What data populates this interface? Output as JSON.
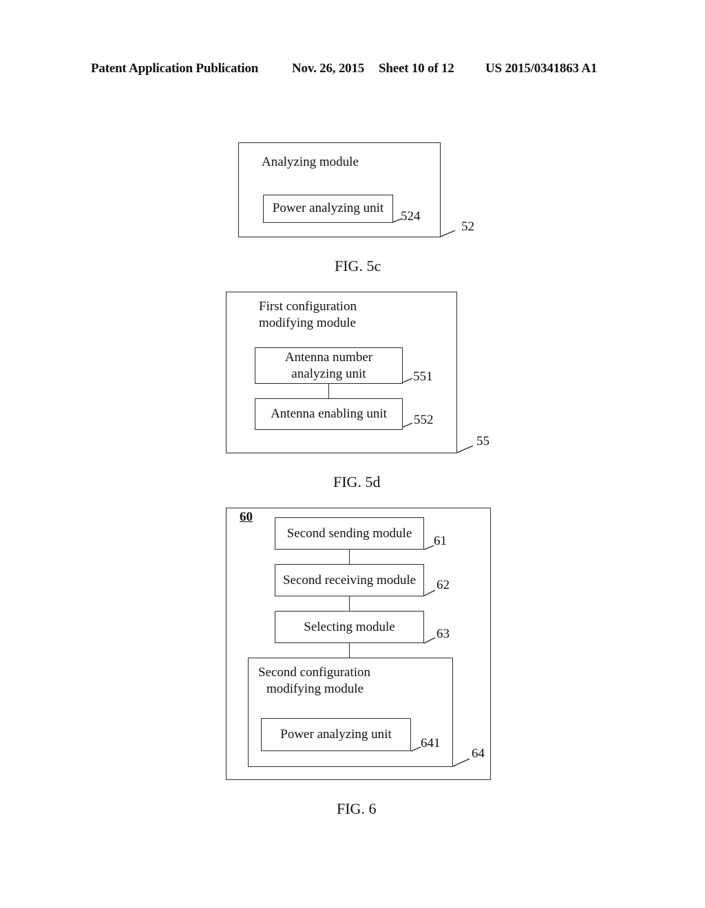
{
  "header": {
    "publication": "Patent Application Publication",
    "date": "Nov. 26, 2015",
    "sheet": "Sheet 10 of 12",
    "number": "US 2015/0341863 A1"
  },
  "fig5c": {
    "caption": "FIG. 5c",
    "module": {
      "label": "Analyzing module",
      "ref": "52"
    },
    "units": [
      {
        "label": "Power analyzing unit",
        "ref": "524"
      }
    ]
  },
  "fig5d": {
    "caption": "FIG. 5d",
    "module": {
      "label_line1": "First configuration",
      "label_line2": "modifying module",
      "ref": "55"
    },
    "units": [
      {
        "label_line1": "Antenna number",
        "label_line2": "analyzing unit",
        "ref": "551"
      },
      {
        "label": "Antenna enabling unit",
        "ref": "552"
      }
    ]
  },
  "fig6": {
    "caption": "FIG. 6",
    "system_ref": "60",
    "modules": [
      {
        "label": "Second sending module",
        "ref": "61"
      },
      {
        "label": "Second receiving module",
        "ref": "62"
      },
      {
        "label": "Selecting module",
        "ref": "63"
      }
    ],
    "config_module": {
      "label_line1": "Second configuration",
      "label_line2": "modifying module",
      "ref": "64",
      "unit": {
        "label": "Power analyzing unit",
        "ref": "641"
      }
    }
  }
}
